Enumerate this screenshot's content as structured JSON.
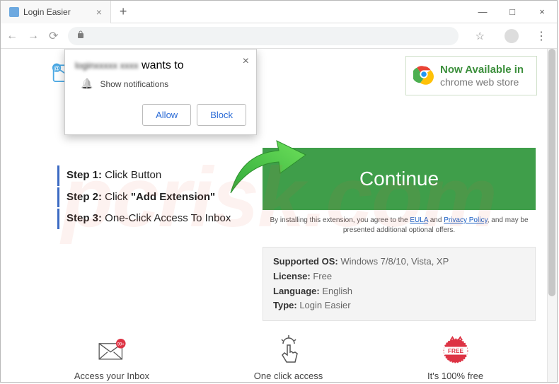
{
  "window": {
    "tab_title": "Login Easier",
    "minimize": "—",
    "maximize": "□",
    "close": "×"
  },
  "popup": {
    "origin": "loginxxxxx xxxx",
    "wants_to": " wants to",
    "permission": "Show notifications",
    "allow": "Allow",
    "block": "Block"
  },
  "webstore": {
    "line1": "Now Available in",
    "line2": "chrome web store"
  },
  "steps": {
    "s1_label": "Step 1:",
    "s1_text": " Click Button",
    "s2_label": "Step 2:",
    "s2_text": " Click ",
    "s2_quote": "\"Add Extension\"",
    "s3_label": "Step 3:",
    "s3_text": " One-Click Access To Inbox"
  },
  "cta": {
    "continue": "Continue",
    "disclaimer_pre": "By installing this extension, you agree to the ",
    "eula": "EULA",
    "and": " and ",
    "pp": "Privacy Policy",
    "disclaimer_post": ", and may be presented additional optional offers."
  },
  "info": {
    "os_label": "Supported OS:",
    "os_val": " Windows 7/8/10, Vista, XP",
    "license_label": "License:",
    "license_val": " Free",
    "lang_label": "Language:",
    "lang_val": " English",
    "type_label": "Type:",
    "type_val": " Login Easier"
  },
  "features": {
    "f1": "Access your Inbox",
    "f2": "One click access",
    "f3": "It's 100% free"
  }
}
